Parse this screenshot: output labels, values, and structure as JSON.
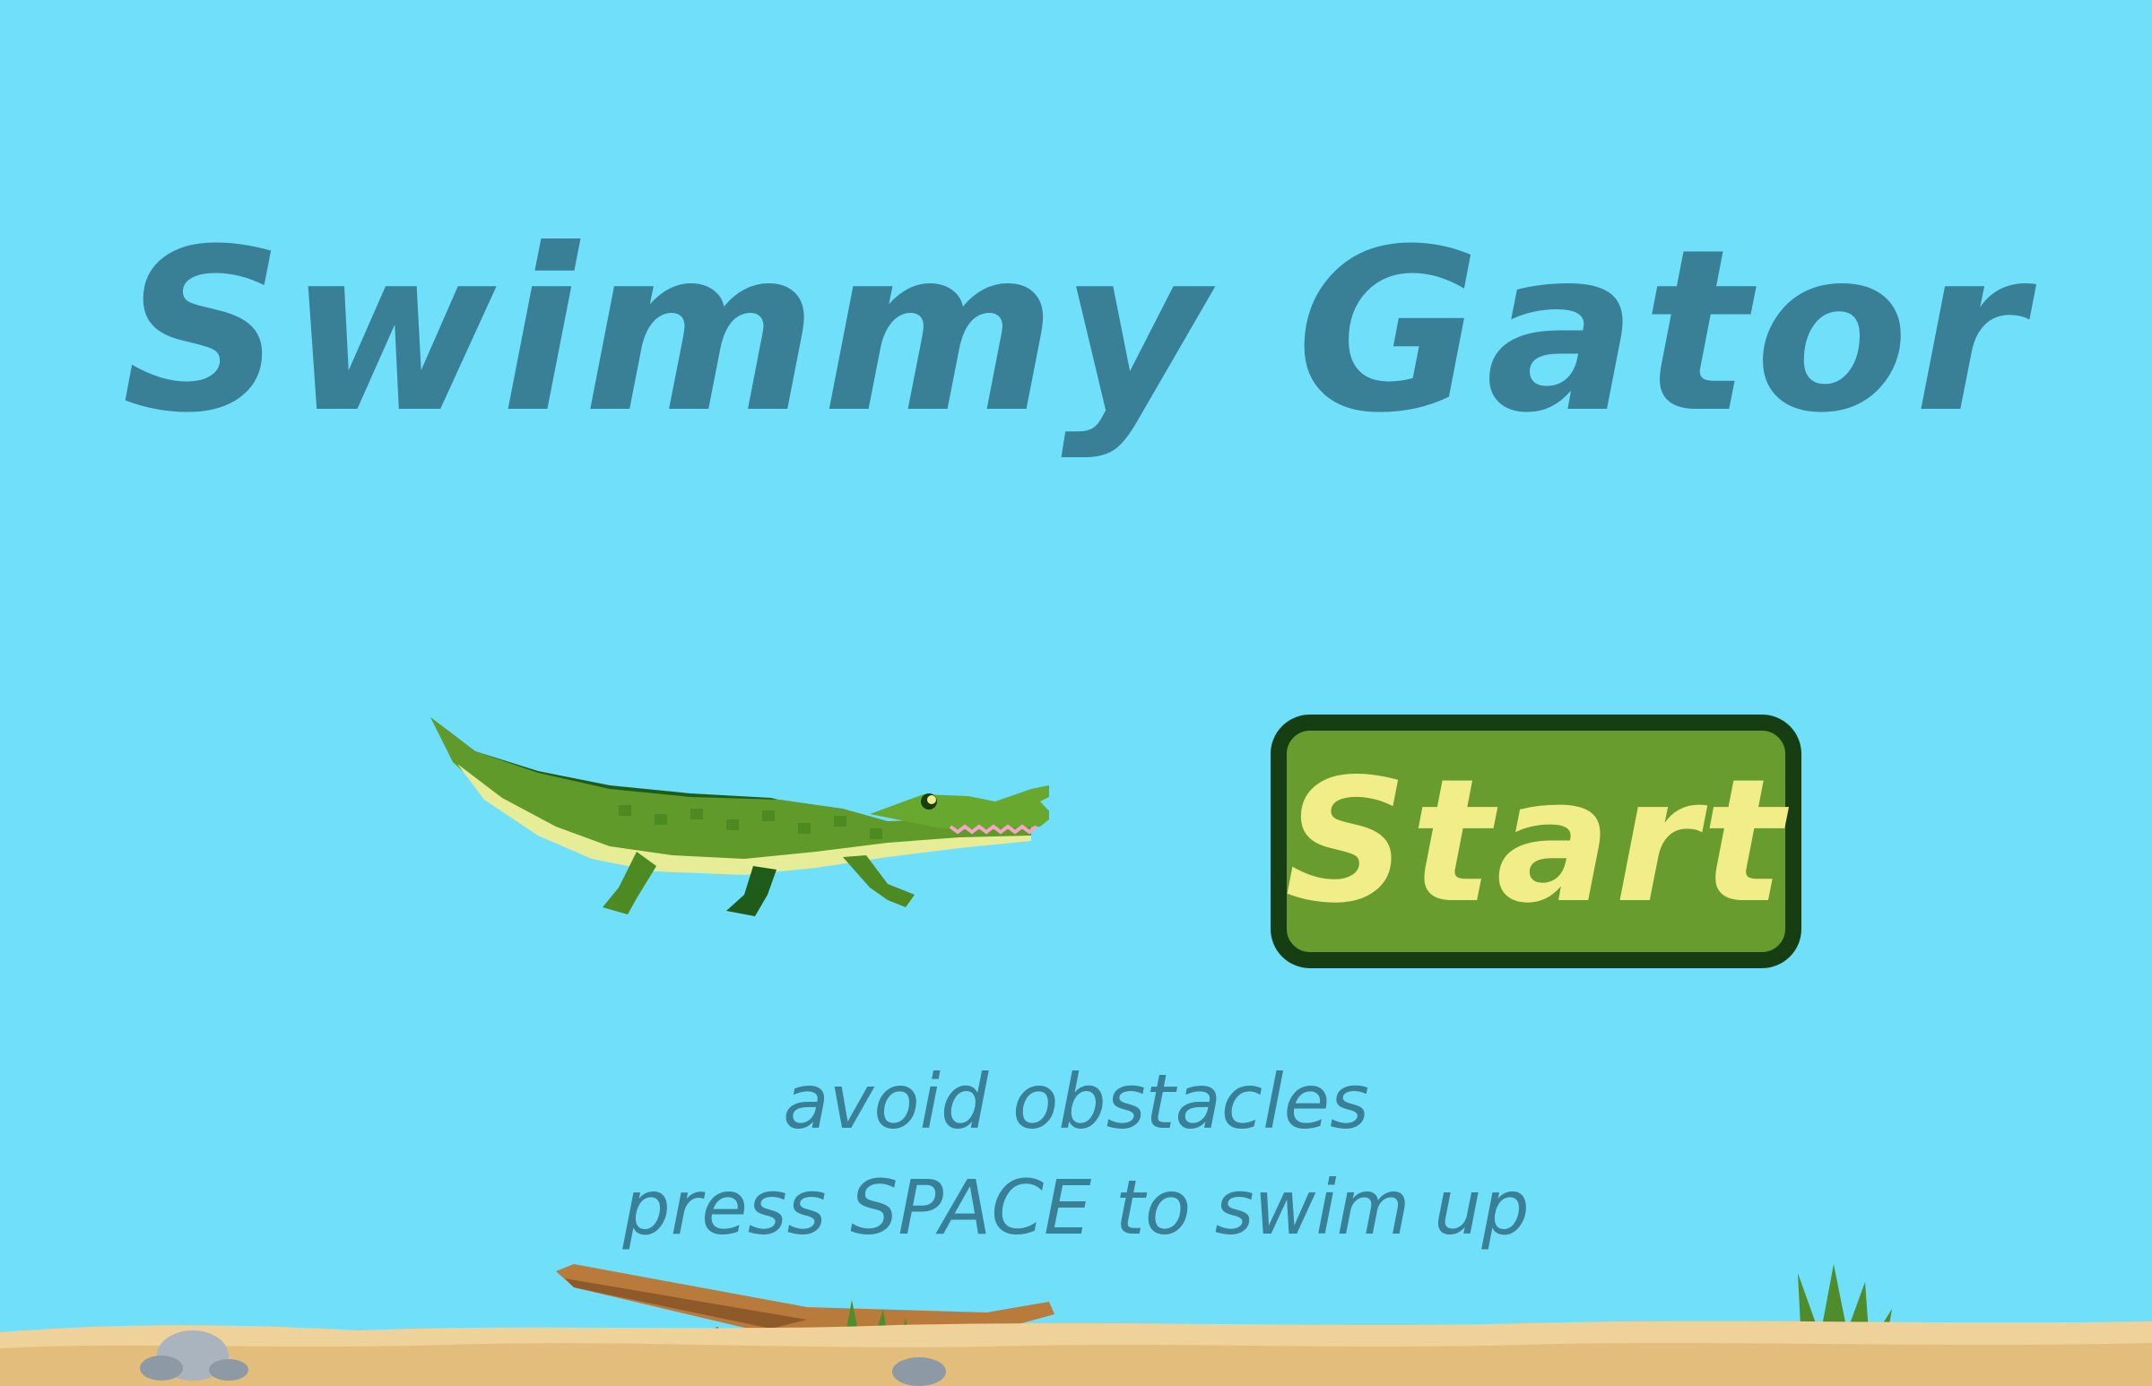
{
  "game": {
    "title": "Swimmy Gator",
    "start_label": "Start",
    "instructions": {
      "line1": "avoid obstacles",
      "line2": "press SPACE to swim up"
    }
  },
  "palette": {
    "water": "#70dffa",
    "title_text": "#397f96",
    "button_fill": "#689c2e",
    "button_border": "#173d13",
    "button_text": "#f1ed88",
    "gator_green": "#5f9a2a",
    "gator_belly": "#e7ec97",
    "sand": "#e8c98b",
    "driftwood": "#b97b3c",
    "rock": "#a9b4be",
    "seaweed": "#4f8c2c"
  },
  "sprites": [
    "gator-player",
    "seabed",
    "rock",
    "driftwood",
    "seaweed"
  ]
}
